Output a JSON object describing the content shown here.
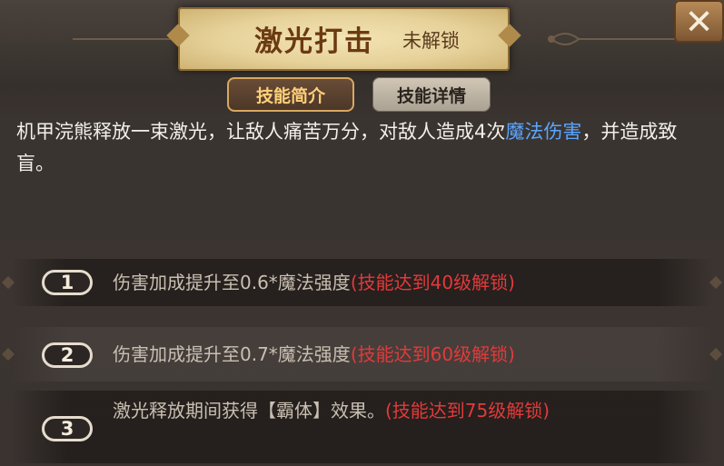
{
  "header": {
    "skill_name": "激光打击",
    "lock_status": "未解锁",
    "close_label": "✕"
  },
  "tabs": [
    {
      "label": "技能简介",
      "active": true
    },
    {
      "label": "技能详情",
      "active": false
    }
  ],
  "description": {
    "text_before": "机甲浣熊释放一束激光，让敌人痛苦万分，对敌人造成4次",
    "highlight": "魔法伤害",
    "text_after": "，并造成致盲。"
  },
  "upgrades": [
    {
      "number": "1",
      "text": "伤害加成提升至0.6*魔法强度",
      "condition": "(技能达到40级解锁)"
    },
    {
      "number": "2",
      "text": "伤害加成提升至0.7*魔法强度",
      "condition": "(技能达到60级解锁)"
    },
    {
      "number": "3",
      "text": "激光释放期间获得【霸体】效果。",
      "condition": "(技能达到75级解锁)"
    }
  ],
  "colors": {
    "title_text": "#6b3a12",
    "active_tab_text": "#ffd07a",
    "highlight_blue": "#5aa6ff",
    "condition_red": "#e23a3a"
  }
}
